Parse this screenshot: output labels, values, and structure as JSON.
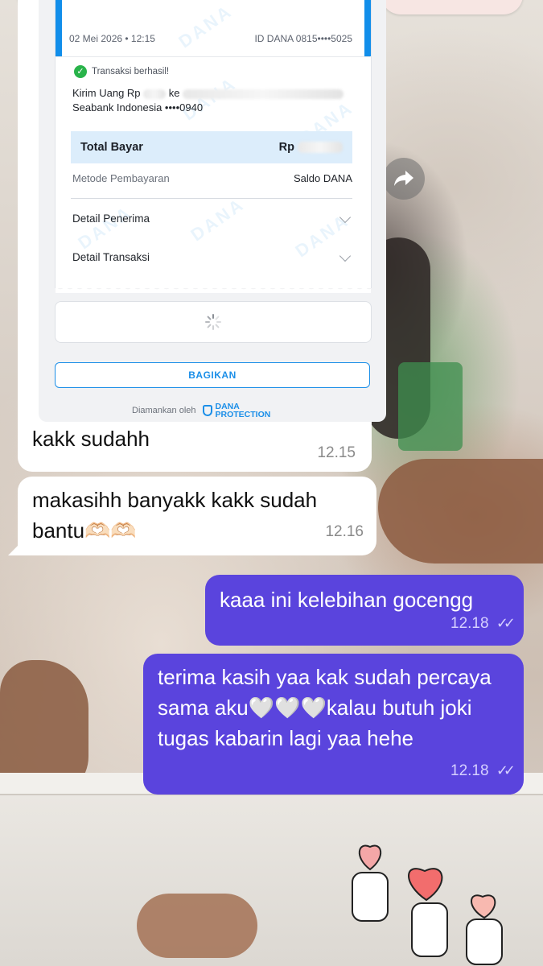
{
  "receipt": {
    "date": "02 Mei 2026 • 12:15",
    "id_dana": "ID DANA 0815••••5025",
    "status": "Transaksi berhasil!",
    "transfer_prefix": "Kirim Uang Rp",
    "transfer_to": "ke",
    "bank": "Seabank Indonesia ••••0940",
    "total_label": "Total Bayar",
    "total_currency": "Rp",
    "method_label": "Metode Pembayaran",
    "method_value": "Saldo DANA",
    "detail_penerima": "Detail Penerima",
    "detail_transaksi": "Detail Transaksi",
    "share_label": "BAGIKAN",
    "secured_by": "Diamankan oleh",
    "protection_line1": "DANA",
    "protection_line2": "PROTECTION",
    "watermark": "DANA"
  },
  "messages": [
    {
      "direction": "in",
      "text": "kakk sudahh",
      "time": "12.15"
    },
    {
      "direction": "in",
      "text": "makasihh banyakk kakk sudah bantu🫶🏻🫶🏻",
      "time": "12.16"
    },
    {
      "direction": "out",
      "text": "kaaa ini kelebihan gocengg",
      "time": "12.18",
      "status": "read"
    },
    {
      "direction": "out",
      "text": "terima kasih yaa kak sudah percaya sama aku🤍🤍🤍kalau butuh joki tugas kabarin lagi yaa hehe",
      "time": "12.18",
      "status": "read"
    }
  ],
  "icons": {
    "forward": "forward-arrow-icon",
    "read_receipt": "double-check-icon",
    "success": "check-circle-icon",
    "loader": "spinner-icon"
  },
  "colors": {
    "outgoing_bubble": "#5a44dd",
    "incoming_bubble": "#ffffff",
    "dana_blue": "#118eea",
    "success_green": "#29b34a"
  }
}
